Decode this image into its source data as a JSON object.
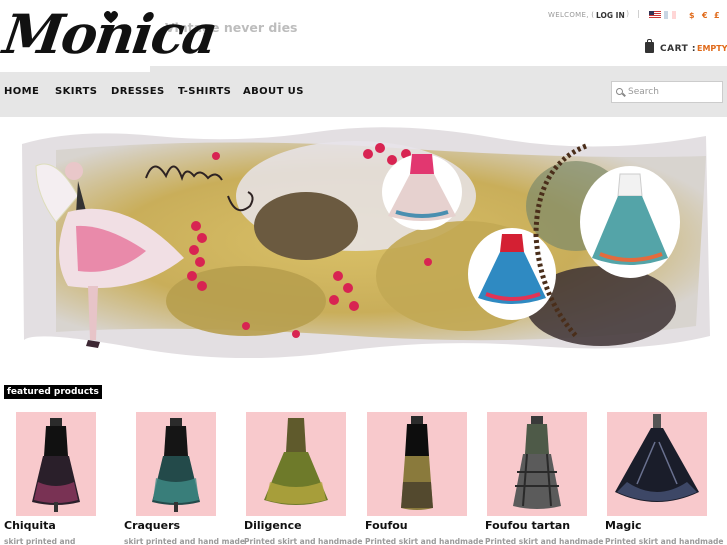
{
  "header": {
    "logo_text": "Monica",
    "tagline": "Vintage never dies",
    "welcome": "WELCOME, (",
    "login_label": "LOG IN",
    "sep1": ")",
    "sep2": "|",
    "currencies": [
      "$",
      "€",
      "£"
    ],
    "cart_label": "CART :",
    "cart_status": "EMPTY"
  },
  "nav": {
    "items": [
      "HOME",
      "SKIRTS",
      "DRESSES",
      "T-SHIRTS",
      "ABOUT US"
    ]
  },
  "search": {
    "placeholder": "Search"
  },
  "featured": {
    "title": "featured products",
    "products": [
      {
        "name": "Chiquita",
        "desc": "skirt printed and"
      },
      {
        "name": "Craquers",
        "desc": "skirt printed and hand made"
      },
      {
        "name": "Diligence",
        "desc": "Printed skirt and handmade"
      },
      {
        "name": "Foufou",
        "desc": "Printed skirt and handmade"
      },
      {
        "name": "Foufou tartan",
        "desc": "Printed skirt and handmade"
      },
      {
        "name": "Magic",
        "desc": "Printed skirt and handmade"
      }
    ]
  },
  "colors": {
    "accent": "#e06a1a",
    "nav_bg": "#e6e6e6",
    "product_bg": "#f8c9cc"
  }
}
